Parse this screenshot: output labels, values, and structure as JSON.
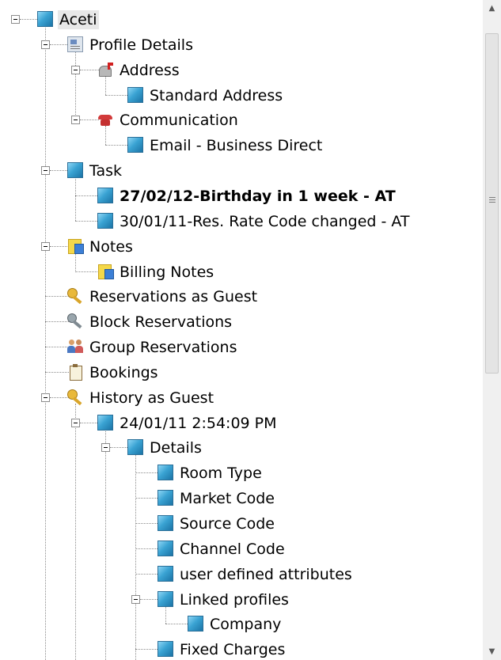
{
  "tree": {
    "nodes": [
      {
        "id": "aceti",
        "label": "Aceti",
        "level": 0,
        "icon": "node-icon",
        "expander": true,
        "selected": true
      },
      {
        "id": "profile",
        "label": "Profile Details",
        "level": 1,
        "icon": "profile-details-icon",
        "expander": true
      },
      {
        "id": "address",
        "label": "Address",
        "level": 2,
        "icon": "mailbox-icon",
        "expander": true
      },
      {
        "id": "std-address",
        "label": "Standard Address",
        "level": 3,
        "icon": "node-icon"
      },
      {
        "id": "communication",
        "label": "Communication",
        "level": 2,
        "icon": "telephone-icon",
        "expander": true
      },
      {
        "id": "email",
        "label": "Email - Business Direct",
        "level": 3,
        "icon": "node-icon"
      },
      {
        "id": "task",
        "label": "Task",
        "level": 1,
        "icon": "node-icon",
        "expander": true
      },
      {
        "id": "task1",
        "label": "27/02/12-Birthday in 1 week  - AT",
        "level": 2,
        "icon": "node-icon",
        "bold": true
      },
      {
        "id": "task2",
        "label": "30/01/11-Res. Rate Code changed - AT",
        "level": 2,
        "icon": "node-icon"
      },
      {
        "id": "notes",
        "label": "Notes",
        "level": 1,
        "icon": "notes-icon",
        "expander": true
      },
      {
        "id": "billing",
        "label": "Billing Notes",
        "level": 2,
        "icon": "notes-icon"
      },
      {
        "id": "res-guest",
        "label": "Reservations as Guest",
        "level": 1,
        "icon": "key-icon"
      },
      {
        "id": "block",
        "label": "Block Reservations",
        "level": 1,
        "icon": "block-key-icon"
      },
      {
        "id": "group",
        "label": "Group Reservations",
        "level": 1,
        "icon": "group-people-icon"
      },
      {
        "id": "bookings",
        "label": "Bookings",
        "level": 1,
        "icon": "clipboard-icon"
      },
      {
        "id": "history",
        "label": "History as Guest",
        "level": 1,
        "icon": "key-icon",
        "expander": true
      },
      {
        "id": "hist-date",
        "label": "24/01/11 2:54:09 PM",
        "level": 2,
        "icon": "node-icon",
        "expander": true
      },
      {
        "id": "details",
        "label": "Details",
        "level": 3,
        "icon": "node-icon",
        "expander": true
      },
      {
        "id": "room",
        "label": "Room Type",
        "level": 4,
        "icon": "node-icon"
      },
      {
        "id": "market",
        "label": "Market Code",
        "level": 4,
        "icon": "node-icon"
      },
      {
        "id": "source",
        "label": "Source Code",
        "level": 4,
        "icon": "node-icon"
      },
      {
        "id": "channel",
        "label": "Channel Code",
        "level": 4,
        "icon": "node-icon"
      },
      {
        "id": "uda",
        "label": "user defined attributes",
        "level": 4,
        "icon": "node-icon"
      },
      {
        "id": "linked",
        "label": "Linked profiles",
        "level": 4,
        "icon": "node-icon",
        "expander": true
      },
      {
        "id": "company",
        "label": "Company",
        "level": 5,
        "icon": "node-icon"
      },
      {
        "id": "fixed",
        "label": "Fixed Charges",
        "level": 4,
        "icon": "node-icon"
      }
    ]
  },
  "scrollbar": {
    "up_arrow": "▲",
    "down_arrow": "▼"
  }
}
